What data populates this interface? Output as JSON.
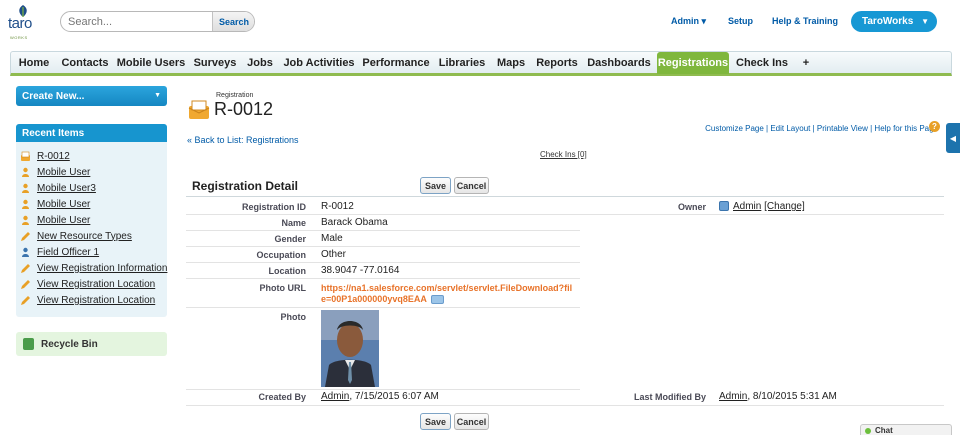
{
  "header": {
    "logo_text": "taro",
    "logo_tag": "WORKS",
    "search_placeholder": "Search...",
    "search_button": "Search",
    "user_menu": "Admin",
    "setup": "Setup",
    "help": "Help & Training",
    "app_menu": "TaroWorks"
  },
  "tabs": [
    "Home",
    "Contacts",
    "Mobile Users",
    "Surveys",
    "Jobs",
    "Job Activities",
    "Performance",
    "Libraries",
    "Maps",
    "Reports",
    "Dashboards",
    "Registrations",
    "Check Ins",
    "+"
  ],
  "active_tab": "Registrations",
  "sidebar": {
    "create_new": "Create New...",
    "recent_title": "Recent Items",
    "recent_items": [
      {
        "label": "R-0012",
        "icon": "registration-icon"
      },
      {
        "label": "Mobile User",
        "icon": "mobile-user-icon"
      },
      {
        "label": "Mobile User3",
        "icon": "mobile-user-icon"
      },
      {
        "label": "Mobile User",
        "icon": "mobile-user-icon"
      },
      {
        "label": "Mobile User",
        "icon": "mobile-user-icon"
      },
      {
        "label": "New Resource Types",
        "icon": "pencil-icon"
      },
      {
        "label": "Field Officer 1",
        "icon": "person-icon"
      },
      {
        "label": "View Registration Information",
        "icon": "pencil-icon"
      },
      {
        "label": "View Registration Location",
        "icon": "pencil-icon"
      },
      {
        "label": "View Registration Location",
        "icon": "pencil-icon"
      }
    ],
    "recycle_bin": "Recycle Bin"
  },
  "record": {
    "type": "Registration",
    "name": "R-0012",
    "back_link": "« Back to List: Registrations",
    "page_links": "Customize Page | Edit Layout | Printable View | Help for this Page",
    "related_link": "Check Ins [0]",
    "detail_title": "Registration Detail",
    "save": "Save",
    "cancel": "Cancel"
  },
  "fields": {
    "registration_id_label": "Registration ID",
    "registration_id": "R-0012",
    "owner_label": "Owner",
    "owner": "Admin",
    "owner_change": "[Change]",
    "name_label": "Name",
    "name": "Barack Obama",
    "gender_label": "Gender",
    "gender": "Male",
    "occupation_label": "Occupation",
    "occupation": "Other",
    "location_label": "Location",
    "location": "38.9047 -77.0164",
    "photo_url_label": "Photo URL",
    "photo_url": "https://na1.salesforce.com/servlet/servlet.FileDownload?file=00P1a000000yvq8EAA",
    "photo_label": "Photo",
    "created_by_label": "Created By",
    "created_by_user": "Admin",
    "created_by_date": ", 7/15/2015 6:07 AM",
    "modified_by_label": "Last Modified By",
    "modified_by_user": "Admin",
    "modified_by_date": ", 8/10/2015 5:31 AM"
  },
  "chat": "Chat",
  "colors": {
    "accent_blue": "#1798d4",
    "active_tab_green": "#7fb73d",
    "link_orange": "#e8732a"
  }
}
